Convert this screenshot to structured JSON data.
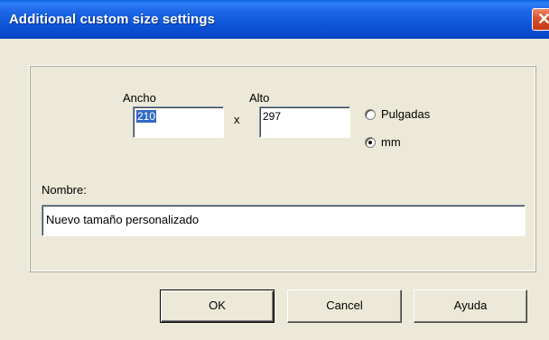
{
  "window": {
    "title": "Additional custom size settings"
  },
  "size": {
    "width_label": "Ancho",
    "width_value": "210",
    "height_label": "Alto",
    "height_value": "297",
    "separator": "x"
  },
  "units": {
    "options": [
      {
        "label": "Pulgadas",
        "selected": false
      },
      {
        "label": "mm",
        "selected": true
      }
    ]
  },
  "name": {
    "label": "Nombre:",
    "value": "Nuevo tamaño personalizado"
  },
  "buttons": {
    "ok": "OK",
    "cancel": "Cancel",
    "help": "Ayuda"
  },
  "icons": {
    "close": "close-icon"
  },
  "colors": {
    "titlebar": "#0b52d6",
    "dialog_bg": "#ece9d8",
    "close": "#d9502c",
    "selection": "#316ac5"
  }
}
